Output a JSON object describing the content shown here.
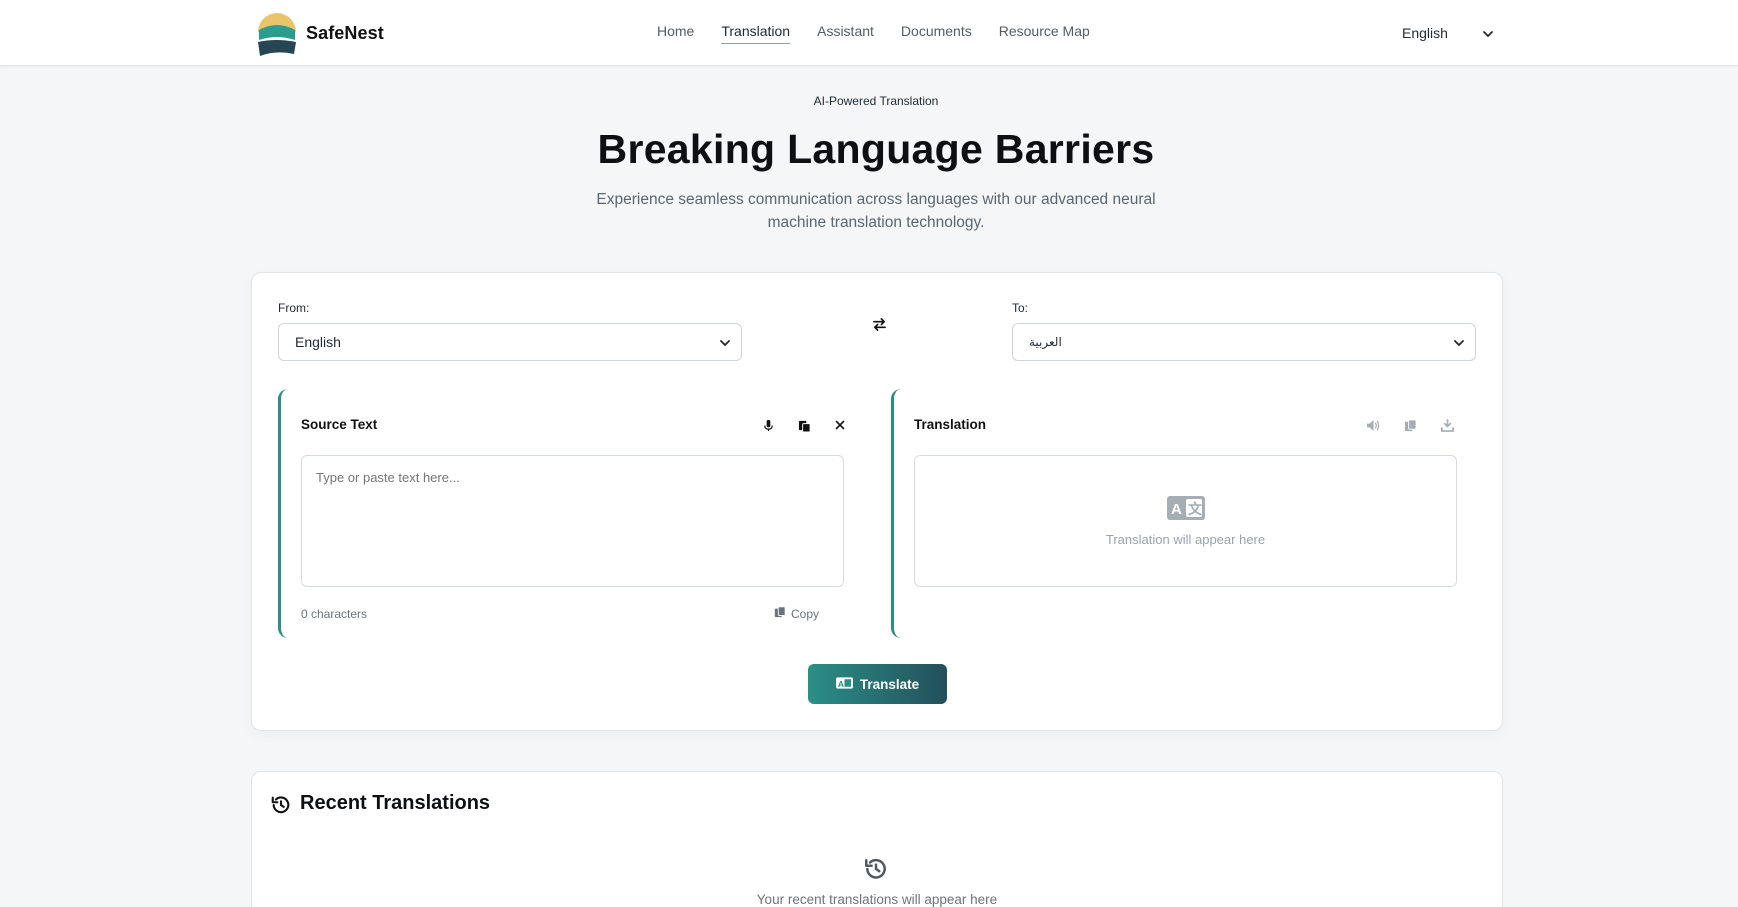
{
  "header": {
    "brand": "SafeNest",
    "nav": [
      {
        "label": "Home",
        "active": false
      },
      {
        "label": "Translation",
        "active": true
      },
      {
        "label": "Assistant",
        "active": false
      },
      {
        "label": "Documents",
        "active": false
      },
      {
        "label": "Resource Map",
        "active": false
      }
    ],
    "language": "English"
  },
  "hero": {
    "eyebrow": "AI-Powered Translation",
    "title": "Breaking Language Barriers",
    "subtitle": "Experience seamless communication across languages with our advanced neural machine translation technology."
  },
  "translator": {
    "from_label": "From:",
    "from_value": "English",
    "to_label": "To:",
    "to_value": "العربية",
    "source_title": "Source Text",
    "source_placeholder": "Type or paste text here...",
    "char_count": "0 characters",
    "copy_label": "Copy",
    "result_title": "Translation",
    "result_placeholder": "Translation will appear here",
    "translate_label": "Translate"
  },
  "recent": {
    "title": "Recent Translations",
    "empty": "Your recent translations will appear here"
  },
  "colors": {
    "accent": "#2a8f86",
    "accent_dark": "#24505a",
    "logo_yellow": "#e9c46a",
    "logo_teal": "#2a9d8f",
    "logo_dark": "#264653"
  }
}
